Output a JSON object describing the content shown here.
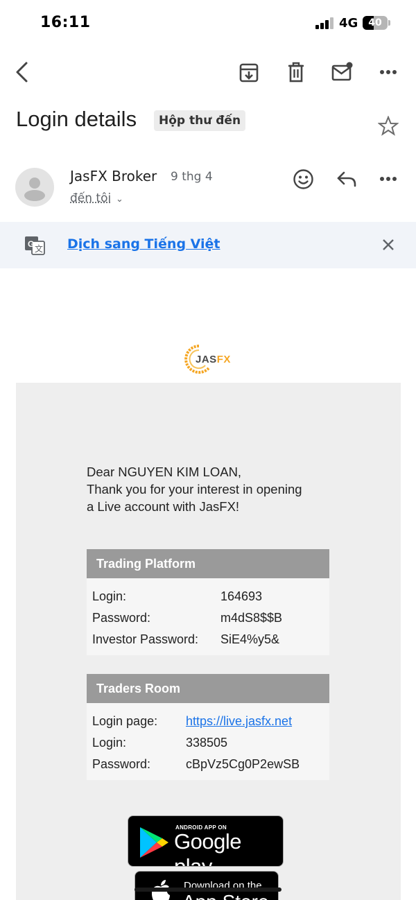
{
  "status_bar": {
    "time": "16:11",
    "network": "4G",
    "battery": "40"
  },
  "toolbar": {
    "icons": [
      "back-arrow-icon",
      "archive-icon",
      "delete-icon",
      "mark-unread-icon",
      "more-icon"
    ]
  },
  "message": {
    "subject": "Login details",
    "label": "Hộp thư đến",
    "sender_name": "JasFX Broker",
    "date": "9 thg 4",
    "recipient": "đến tôi"
  },
  "translate": {
    "link_text": "Dịch sang Tiếng Việt"
  },
  "email": {
    "logo_text_a": "JAS",
    "logo_text_b": "FX",
    "greeting": [
      "Dear NGUYEN KIM LOAN,",
      "Thank you for your interest in opening",
      "a Live account with JasFX!"
    ],
    "trading_platform": {
      "title": "Trading Platform",
      "rows": [
        {
          "label": "Login:",
          "value": "164693"
        },
        {
          "label": "Password:",
          "value": "m4dS8$$B"
        },
        {
          "label": "Investor Password:",
          "value": "SiE4%y5&"
        }
      ]
    },
    "traders_room": {
      "title": "Traders Room",
      "rows": [
        {
          "label": "Login page:",
          "value": "https://live.jasfx.net"
        },
        {
          "label": "Login:",
          "value": "338505"
        },
        {
          "label": "Password:",
          "value": "cBpVz5Cg0P2ewSB"
        }
      ]
    },
    "google_play": {
      "small": "ANDROID APP ON",
      "big": "Google play"
    },
    "app_store": {
      "small": "Download on the",
      "big": "App Store"
    }
  },
  "colors": {
    "link": "#1a73e8",
    "panel_header": "#9a9a9a",
    "translate_bar": "#f1f4f9",
    "brand_orange": "#f5a623"
  }
}
